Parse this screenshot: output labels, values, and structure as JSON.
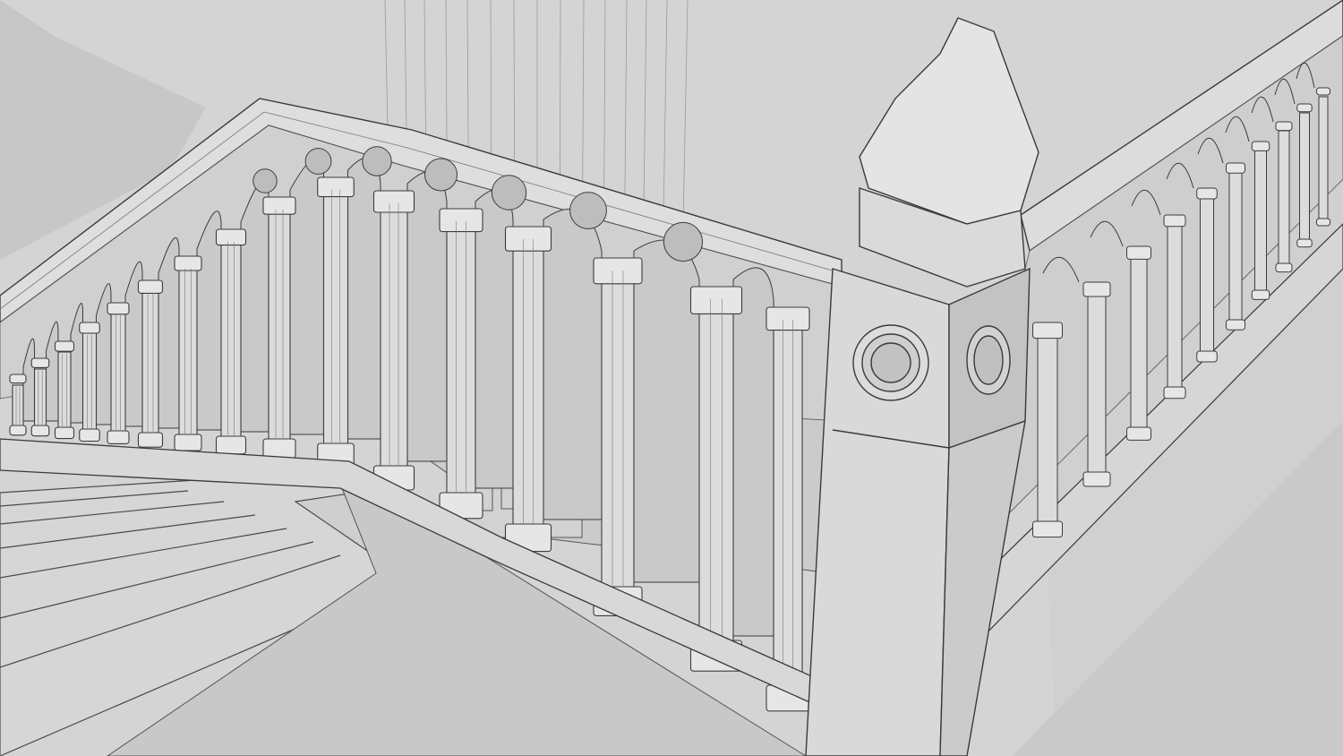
{
  "scene": {
    "subject": "stair-balustrade",
    "render_style": "clay-wireframe",
    "colors": {
      "background": "#d3d3d3",
      "wall": "#c9c9c9",
      "floor": "#cfcfcf",
      "surface": "#dcdcdc",
      "surface_light": "#e6e6e6",
      "surface_shadow": "#b9b9b9",
      "edge": "#3c3c3c",
      "wire": "#7a7a7a"
    }
  }
}
